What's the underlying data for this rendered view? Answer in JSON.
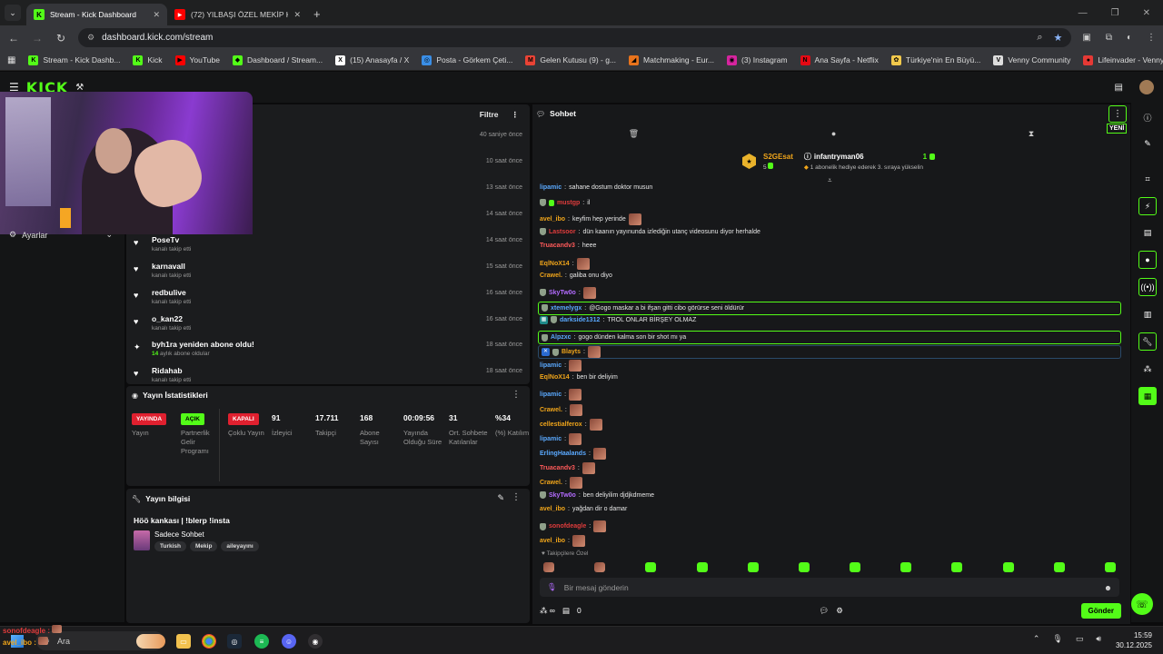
{
  "browser": {
    "tabs": [
      {
        "title": "Stream - Kick Dashboard",
        "active": true,
        "fav": "K",
        "favcolor": "#53fc18"
      },
      {
        "title": "(72) YILBAŞI ÖZEL MEKİP KOMİ",
        "active": false,
        "fav": "▶",
        "favcolor": "#ff0000"
      }
    ],
    "url": "dashboard.kick.com/stream",
    "bookmarks": [
      {
        "label": "Stream - Kick Dashb...",
        "icon": "K",
        "color": "#53fc18"
      },
      {
        "label": "Kick",
        "icon": "K",
        "color": "#53fc18"
      },
      {
        "label": "YouTube",
        "icon": "▶",
        "color": "#ff0000"
      },
      {
        "label": "Dashboard / Stream...",
        "icon": "◆",
        "color": "#53fc18"
      },
      {
        "label": "(15) Anasayfa / X",
        "icon": "X",
        "color": "#ffffff"
      },
      {
        "label": "Posta - Görkem Çeti...",
        "icon": "◎",
        "color": "#3a8ee6"
      },
      {
        "label": "Gelen Kutusu (9) - g...",
        "icon": "M",
        "color": "#ea4335"
      },
      {
        "label": "Matchmaking - Eur...",
        "icon": "◢",
        "color": "#e8731c"
      },
      {
        "label": "(3) Instagram",
        "icon": "◉",
        "color": "#d6249f"
      },
      {
        "label": "Ana Sayfa - Netflix",
        "icon": "N",
        "color": "#e50914"
      },
      {
        "label": "Türkiye'nin En Büyü...",
        "icon": "✿",
        "color": "#f2c94c"
      },
      {
        "label": "Venny Community",
        "icon": "V",
        "color": "#dddddd"
      },
      {
        "label": "Lifeinvader - VennyV",
        "icon": "●",
        "color": "#e53935"
      }
    ]
  },
  "kick": {
    "logo": "KICK"
  },
  "sidebar": {
    "settings_label": "Ayarlar"
  },
  "activity": {
    "filter_label": "Filtre",
    "items": [
      {
        "name": "",
        "sub": "",
        "time": "40 saniye önce",
        "icon": "heart"
      },
      {
        "name": "",
        "sub": "",
        "time": "10 saat önce",
        "icon": "heart"
      },
      {
        "name": "",
        "sub": "",
        "time": "13 saat önce",
        "icon": "heart"
      },
      {
        "name": "",
        "sub": "",
        "time": "14 saat önce",
        "icon": "heart"
      },
      {
        "name": "PoseTv",
        "sub": "kanalı takip etti",
        "time": "14 saat önce",
        "icon": "heart"
      },
      {
        "name": "karnavall",
        "sub": "kanalı takip etti",
        "time": "15 saat önce",
        "icon": "heart"
      },
      {
        "name": "redbulive",
        "sub": "kanalı takip etti",
        "time": "16 saat önce",
        "icon": "heart"
      },
      {
        "name": "o_kan22",
        "sub": "kanalı takip etti",
        "time": "16 saat önce",
        "icon": "heart"
      },
      {
        "name": "byh1ra yeniden abone oldu!",
        "sub_count": "14",
        "sub": "aylık abone oldular",
        "time": "18 saat önce",
        "icon": "star"
      },
      {
        "name": "Ridahab",
        "sub": "kanalı takip etti",
        "time": "18 saat önce",
        "icon": "heart"
      }
    ]
  },
  "stats": {
    "title": "Yayın İstatistikleri",
    "items": [
      {
        "value": "YAYINDA",
        "label": "Yayın",
        "badge": true,
        "color": "#e0202f"
      },
      {
        "value": "AÇIK",
        "label": "Partnerlik Gelir Programı",
        "badge": true,
        "color": "#53fc18"
      },
      {
        "value": "KAPALI",
        "label": "Çoklu Yayın",
        "badge": true,
        "color": "#e0202f"
      },
      {
        "value": "91",
        "label": "İzleyici"
      },
      {
        "value": "17.711",
        "label": "Takipçi"
      },
      {
        "value": "168",
        "label": "Abone Sayısı"
      },
      {
        "value": "00:09:56",
        "label": "Yayında Olduğu Süre"
      },
      {
        "value": "31",
        "label": "Ort. Sohbete Katılanlar"
      },
      {
        "value": "%34",
        "label": "(%) Katılım"
      }
    ]
  },
  "info": {
    "title": "Yayın bilgisi",
    "stream_title": "Höö kankası | !blerp !insta",
    "category": "Sadece Sohbet",
    "tags": [
      "Turkish",
      "Mekip",
      "aileyayını"
    ]
  },
  "chat": {
    "title": "Sohbet",
    "new_label": "YENİ",
    "leader": {
      "name": "S2GEsat",
      "level": "5",
      "gifter": "infantryman06",
      "count": "1",
      "note": "1 abonelik hediye ederek 3. sıraya yükselin"
    },
    "messages": [
      {
        "user": "lipamic",
        "color": "#5aa9ff",
        "text": "sahane dostum doktor musun"
      },
      {
        "user": "mustgp",
        "color": "#e03c3c",
        "text": "il",
        "badges": [
          "shield",
          "g"
        ]
      },
      {
        "user": "avel_ibo",
        "color": "#f0a51a",
        "text": "keyfim hep yerinde",
        "emote": true
      },
      {
        "user": "Lastsoor",
        "color": "#e03c3c",
        "text": "dün kaanın yayınunda izlediğin utanç videosunu diyor herhalde",
        "badges": [
          "shield"
        ]
      },
      {
        "user": "Truacandv3",
        "color": "#ff5a5a",
        "text": "heee"
      },
      {
        "user": "EqlNoX14",
        "color": "#f0a51a",
        "text": "",
        "emote": true
      },
      {
        "user": "Crawel.",
        "color": "#f0a51a",
        "text": "galiba onu diyo"
      },
      {
        "user": "SkyTw0o",
        "color": "#b36bff",
        "text": "",
        "emote": true,
        "badges": [
          "shield"
        ]
      },
      {
        "user": "xtemelygx",
        "color": "#5aa9ff",
        "text": "@Gogo maskar a bi ifşan gitti cibo görürse seni öldürür",
        "hl": true,
        "badges": [
          "shield"
        ]
      },
      {
        "user": "darkside1312",
        "color": "#5aa9ff",
        "text": "TROL ONLAR BİRŞEY OLMAZ",
        "badges": [
          "sq",
          "shield"
        ]
      },
      {
        "user": "Alpzxc",
        "color": "#5aa9ff",
        "text": "gogo dünden kalma son bir shot mı ya",
        "hl": true,
        "badges": [
          "shield"
        ]
      },
      {
        "user": "Blayts",
        "color": "#f0a51a",
        "text": "",
        "emote": true,
        "badges": [
          "sqb",
          "shield"
        ],
        "hlblue": true
      },
      {
        "user": "lipamic",
        "color": "#5aa9ff",
        "text": "",
        "emote": true
      },
      {
        "user": "EqlNoX14",
        "color": "#f0a51a",
        "text": "ben bir deliyim"
      },
      {
        "user": "lipamic",
        "color": "#5aa9ff",
        "text": "",
        "emote": true
      },
      {
        "user": "Crawel.",
        "color": "#f0a51a",
        "text": "",
        "emote": true
      },
      {
        "user": "cellestialferox",
        "color": "#f0a51a",
        "text": "",
        "emote": true
      },
      {
        "user": "lipamic",
        "color": "#5aa9ff",
        "text": "",
        "emote": true
      },
      {
        "user": "ErlingHaalands",
        "color": "#5aa9ff",
        "text": "",
        "emote": true
      },
      {
        "user": "Truacandv3",
        "color": "#ff5a5a",
        "text": "",
        "emote": true
      },
      {
        "user": "Crawel.",
        "color": "#f0a51a",
        "text": "",
        "emote": true
      },
      {
        "user": "SkyTw0o",
        "color": "#b36bff",
        "text": "ben deliyilim djdjkdmeme",
        "badges": [
          "shield"
        ]
      },
      {
        "user": "avel_ibo",
        "color": "#f0a51a",
        "text": "yağdan dir o damar"
      },
      {
        "user": "sonofdeagle",
        "color": "#e03c3c",
        "text": "",
        "emote": true,
        "badges": [
          "shield"
        ]
      },
      {
        "user": "avel_ibo",
        "color": "#f0a51a",
        "text": "",
        "emote": true
      }
    ],
    "followers_only": "Takipçilere Özel",
    "input_placeholder": "Bir mesaj gönderin",
    "points": "0",
    "send_label": "Gönder"
  },
  "taskbar": {
    "search": "Ara",
    "time": "15:59",
    "date": "30.12.2025"
  },
  "overlay": {
    "line1": "sonofdeagle",
    "line2": "avel_ibo"
  },
  "colors": {
    "accent": "#53fc18",
    "live": "#e0202f"
  }
}
